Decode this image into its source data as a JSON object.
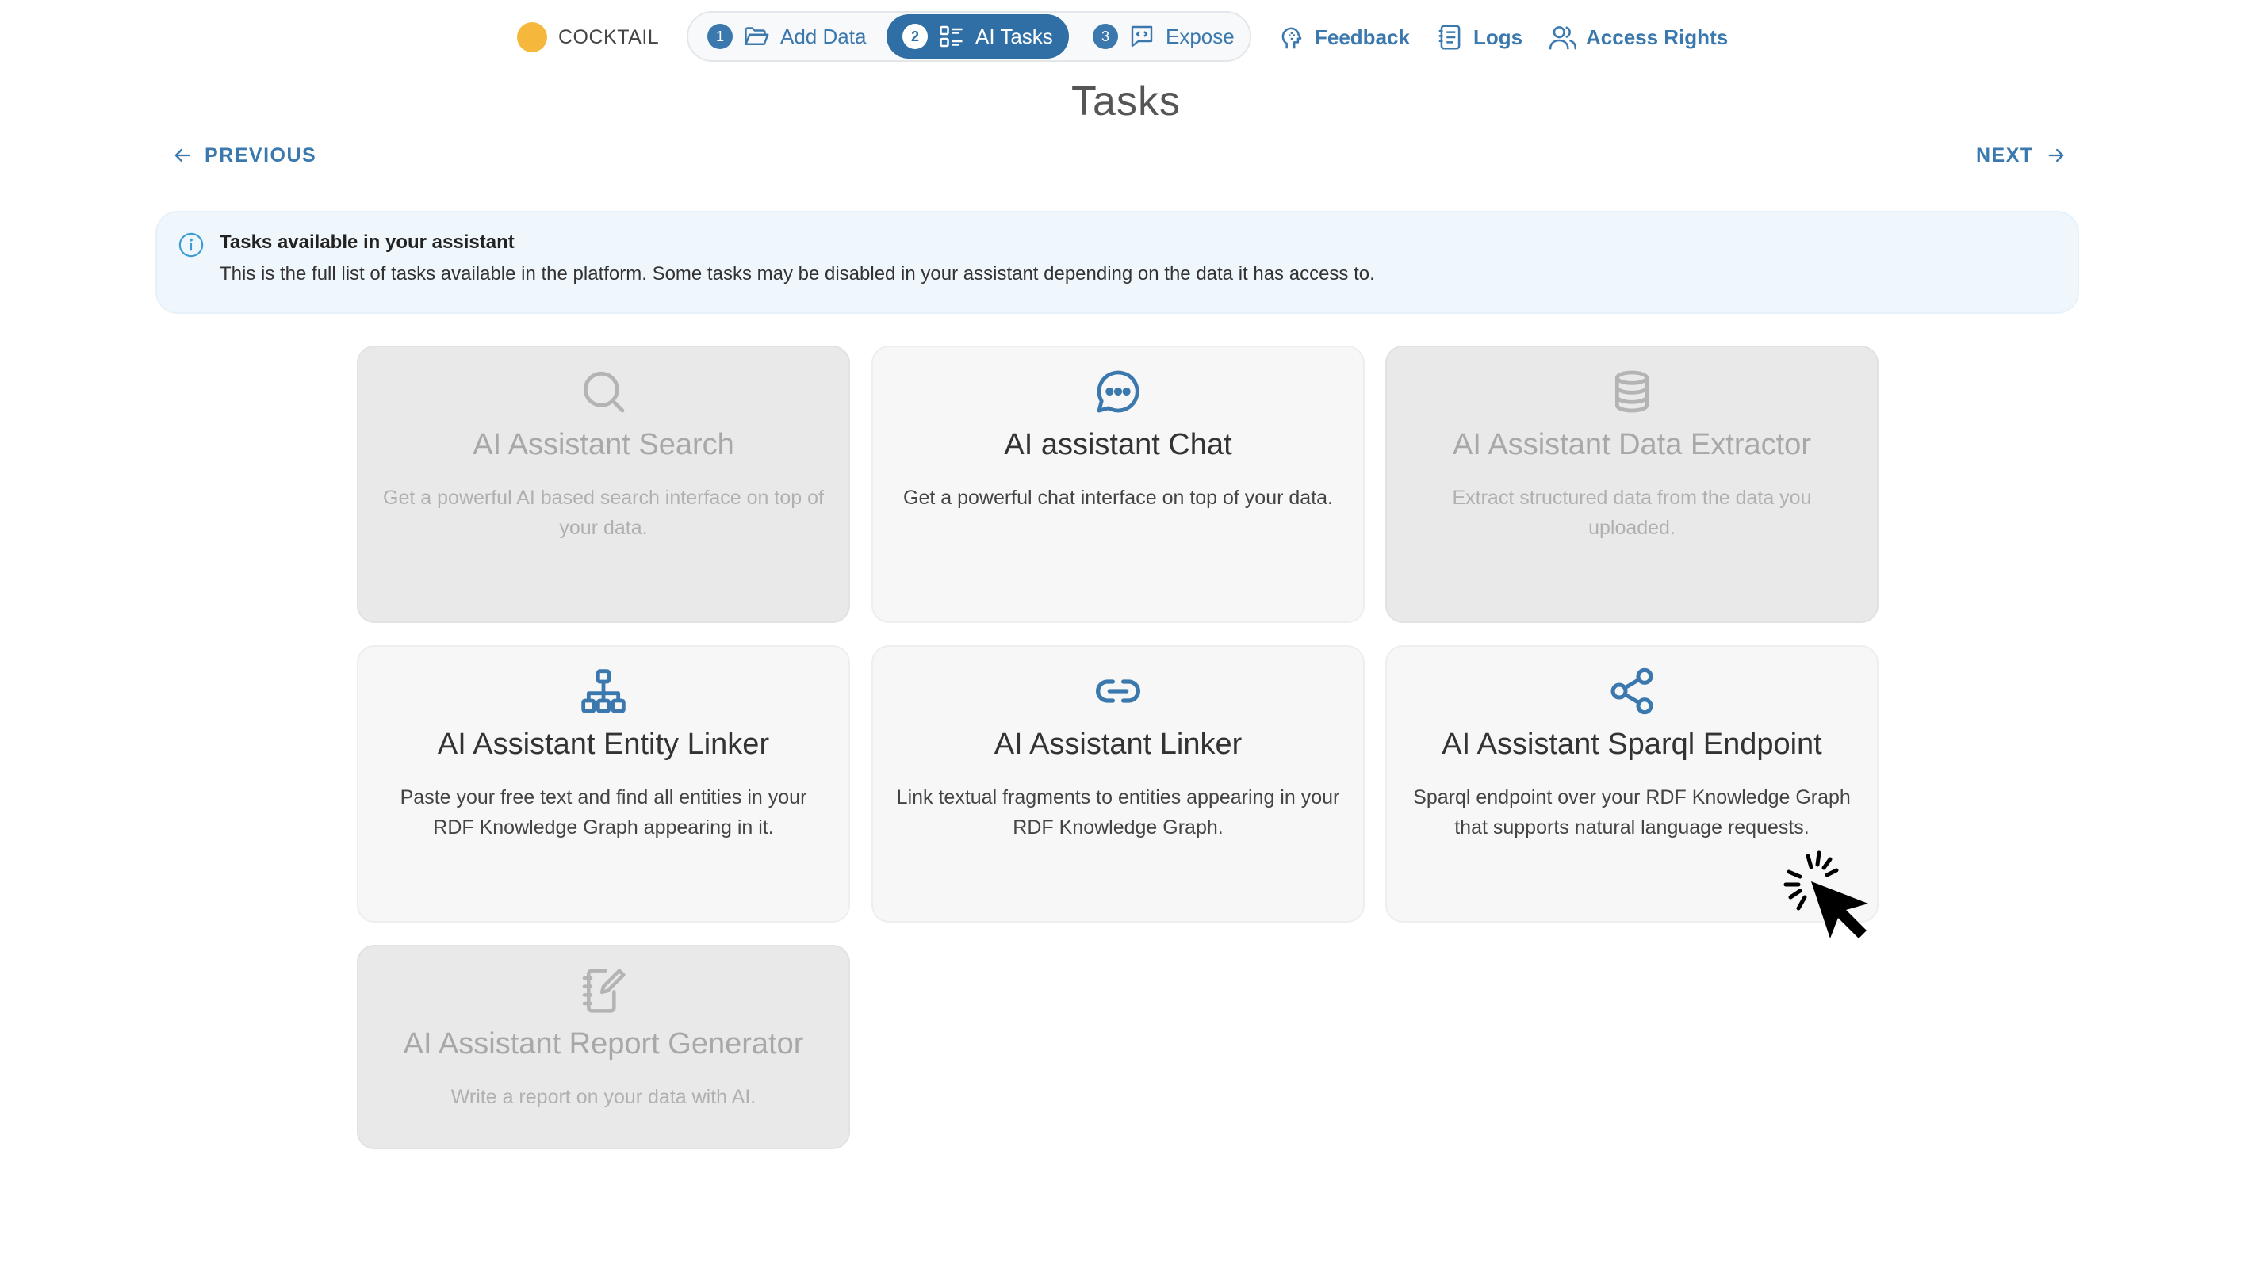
{
  "brand": {
    "name": "COCKTAIL",
    "dot_color": "#f5b83d"
  },
  "stepper": {
    "steps": [
      {
        "number": "1",
        "label": "Add Data",
        "icon": "folder-open-icon"
      },
      {
        "number": "2",
        "label": "AI Tasks",
        "icon": "task-list-icon",
        "active": true
      },
      {
        "number": "3",
        "label": "Expose",
        "icon": "code-message-icon"
      }
    ]
  },
  "nav_links": [
    {
      "label": "Feedback",
      "icon": "feedback-head-icon"
    },
    {
      "label": "Logs",
      "icon": "logs-icon"
    },
    {
      "label": "Access Rights",
      "icon": "users-icon"
    }
  ],
  "page": {
    "title": "Tasks",
    "previous_label": "PREVIOUS",
    "next_label": "NEXT"
  },
  "info": {
    "title": "Tasks available in your assistant",
    "text": "This is the full list of tasks available in the platform. Some tasks may be disabled in your assistant depending on the data it has access to."
  },
  "tasks": [
    {
      "title": "AI Assistant Search",
      "description": "Get a powerful AI based search interface on top of your data.",
      "icon": "search-icon",
      "disabled": true
    },
    {
      "title": "AI assistant Chat",
      "description": "Get a powerful chat interface on top of your data.",
      "icon": "chat-icon",
      "disabled": false
    },
    {
      "title": "AI Assistant Data Extractor",
      "description": "Extract structured data from the data you uploaded.",
      "icon": "database-icon",
      "disabled": true
    },
    {
      "title": "AI Assistant Entity Linker",
      "description": "Paste your free text and find all entities in your RDF Knowledge Graph appearing in it.",
      "icon": "hierarchy-icon",
      "disabled": false
    },
    {
      "title": "AI Assistant Linker",
      "description": "Link textual fragments to entities appearing in your RDF Knowledge Graph.",
      "icon": "link-icon",
      "disabled": false
    },
    {
      "title": "AI Assistant Sparql Endpoint",
      "description": "Sparql endpoint over your RDF Knowledge Graph that supports natural language requests.",
      "icon": "share-icon",
      "disabled": false
    },
    {
      "title": "AI Assistant Report Generator",
      "description": "Write a report on your data with AI.",
      "icon": "report-edit-icon",
      "disabled": true
    }
  ],
  "colors": {
    "accent": "#3a78ad",
    "active_step": "#2f6fa6",
    "info_bg": "#f0f7fc",
    "disabled_card": "#e9e9e9"
  }
}
